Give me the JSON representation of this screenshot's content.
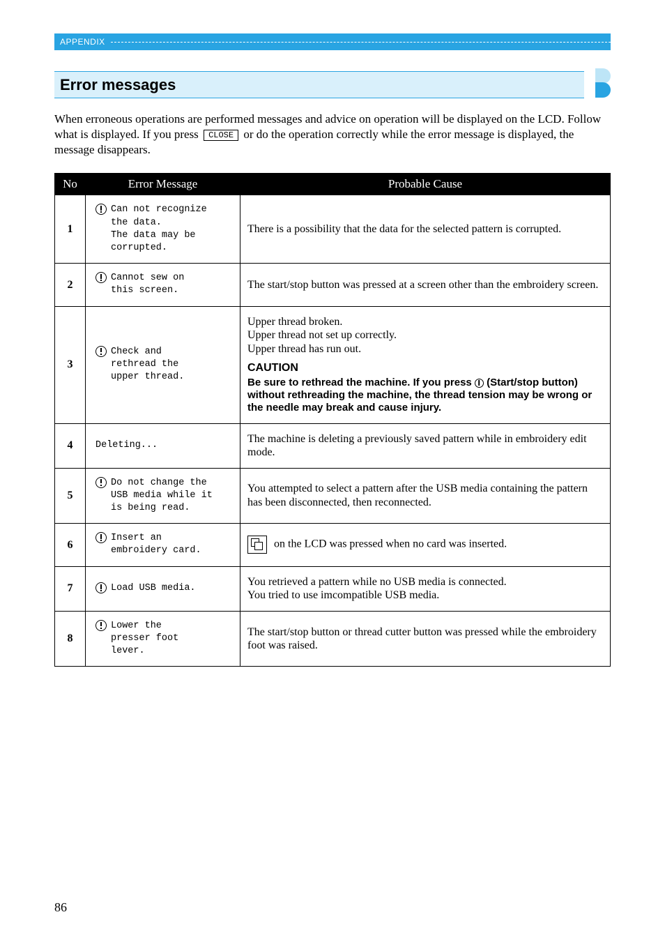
{
  "appendix_label": "APPENDIX",
  "heading": "Error messages",
  "intro_before": "When erroneous operations are performed messages and advice on operation will be displayed on the LCD. Follow what is displayed. If you press ",
  "close_btn_label": "CLOSE",
  "intro_after": " or do the operation correctly while the error message is displayed, the message disappears.",
  "columns": {
    "no": "No",
    "msg": "Error Message",
    "cause": "Probable Cause"
  },
  "rows": [
    {
      "no": "1",
      "msg_has_icon": true,
      "msg": "Can not recognize\nthe data.\nThe data may be\ncorrupted.",
      "cause_lines": [
        "There is a possibility that the data for the selected pattern is corrupted."
      ]
    },
    {
      "no": "2",
      "msg_has_icon": true,
      "msg": "Cannot sew on\nthis screen.",
      "cause_lines": [
        "The start/stop button was pressed at a screen other than the embroidery screen."
      ]
    },
    {
      "no": "3",
      "msg_has_icon": true,
      "msg": "Check and\nrethread the\nupper thread.",
      "cause_lines": [
        "Upper thread broken.",
        "Upper thread not set up correctly.",
        "Upper thread has run out."
      ],
      "caution_head": "CAUTION",
      "caution_body_before": "Be sure to rethread the machine. If you press ",
      "caution_body_after": " (Start/stop button) without rethreading the machine, the thread tension may be wrong or the needle may break and cause injury."
    },
    {
      "no": "4",
      "msg_has_icon": false,
      "msg": "Deleting...",
      "cause_lines": [
        "The machine is deleting a previously saved pattern while in embroidery edit mode."
      ]
    },
    {
      "no": "5",
      "msg_has_icon": true,
      "msg": "Do not change the\nUSB media while it\nis being read.",
      "cause_lines": [
        "You attempted to select a pattern after the USB media containing the pattern has been disconnected, then reconnected."
      ]
    },
    {
      "no": "6",
      "msg_has_icon": true,
      "msg": "Insert an\nembroidery card.",
      "cause_card_icon": true,
      "cause_lines": [
        " on the LCD was pressed when no card was inserted."
      ]
    },
    {
      "no": "7",
      "msg_has_icon": true,
      "msg": "Load USB media.",
      "cause_lines": [
        "You retrieved a pattern while no USB media is connected.",
        "You tried to use imcompatible USB media."
      ]
    },
    {
      "no": "8",
      "msg_has_icon": true,
      "msg": "Lower the\npresser foot\nlever.",
      "cause_lines": [
        "The start/stop button or thread cutter button was pressed while the embroidery foot was raised."
      ]
    }
  ],
  "page_number": "86"
}
